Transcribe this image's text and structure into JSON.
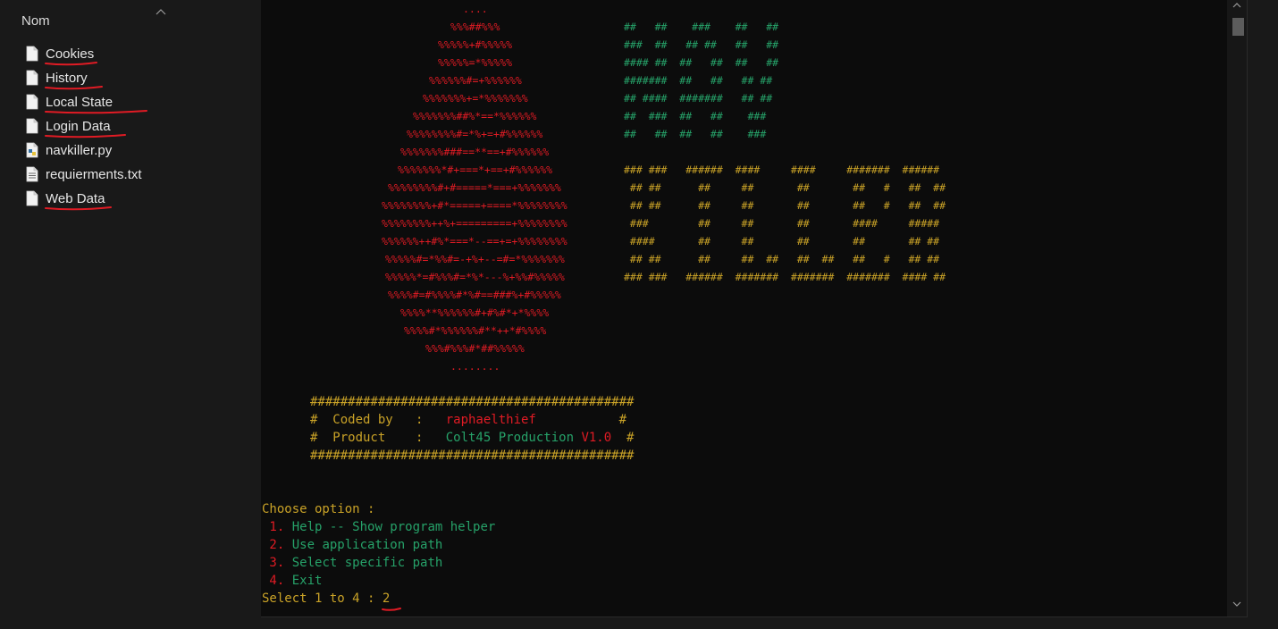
{
  "explorer": {
    "column_header": "Nom",
    "files": [
      {
        "name": "Cookies",
        "icon": "file-icon",
        "underlined": true
      },
      {
        "name": "History",
        "icon": "file-icon",
        "underlined": true
      },
      {
        "name": "Local State",
        "icon": "file-icon",
        "underlined": true
      },
      {
        "name": "Login Data",
        "icon": "file-icon",
        "underlined": true
      },
      {
        "name": "navkiller.py",
        "icon": "python-file-icon",
        "underlined": false
      },
      {
        "name": "requierments.txt",
        "icon": "text-file-icon",
        "underlined": false
      },
      {
        "name": "Web Data",
        "icon": "file-icon",
        "underlined": true
      }
    ]
  },
  "terminal": {
    "colors": {
      "red": "#e01b24",
      "green": "#26a269",
      "yellow": "#c9a227",
      "white": "#cccccc",
      "background": "#0c0c0c",
      "annotation": "#e01b24"
    },
    "logo_art": [
      "....",
      "%%%##%%%",
      "%%%%%+#%%%%%",
      "%%%%%=*%%%%%",
      "%%%%%%#=+%%%%%%",
      "%%%%%%%+=*%%%%%%%",
      "%%%%%%%##%*==*%%%%%%",
      "%%%%%%%%#=*%+=+#%%%%%%",
      "%%%%%%%###==**==+#%%%%%%",
      "%%%%%%%*#+===*+==+#%%%%%%",
      "%%%%%%%%#+#=====*===+%%%%%%%",
      "%%%%%%%%+#*=====+====*%%%%%%%%",
      "%%%%%%%%++%+=========+%%%%%%%%",
      "%%%%%%++#%*===*--==+=+%%%%%%%%",
      "%%%%%#=*%%#=-+%+--=#=*%%%%%%%",
      "%%%%%*=#%%%#=*%*---%+%%#%%%%%",
      "%%%%#=#%%%%#*%#==###%+#%%%%%",
      "%%%%**%%%%%%#+#%#*+*%%%%",
      "%%%%#*%%%%%%#**++*#%%%%",
      "%%%#%%%#*##%%%%%",
      "........"
    ],
    "nav_art": [
      "##   ##    ###    ##   ##",
      "###  ##   ## ##   ##   ##",
      "#### ##  ##   ##  ##   ##",
      "#######  ##   ##   ## ##",
      "## ####  #######   ## ##",
      "##  ###  ##   ##    ###",
      "##   ##  ##   ##    ###"
    ],
    "killer_art": [
      "### ###   ######  ####     ####     #######  ######",
      " ## ##      ##     ##       ##       ##   #   ##  ##",
      " ## ##      ##     ##       ##       ##   #   ##  ##",
      " ###        ##     ##       ##       ####     #####",
      " ####       ##     ##       ##       ##       ## ##",
      " ## ##      ##     ##  ##   ##  ##   ##   #   ## ##",
      "### ###   ######  #######  #######  #######  #### ##"
    ],
    "banner": {
      "border": "###########################################",
      "coded_by_label": "#  Coded by   :   ",
      "coded_by_value": "raphaelthief",
      "coded_by_end": "           #",
      "product_label": "#  Product    :   ",
      "product_name": "Colt45 Production ",
      "product_version": "V1.0",
      "product_end": "  #"
    },
    "menu": {
      "title": "Choose option :",
      "options": [
        {
          "number": " 1.",
          "text": " Help -- Show program helper"
        },
        {
          "number": " 2.",
          "text": " Use application path"
        },
        {
          "number": " 3.",
          "text": " Select specific path"
        },
        {
          "number": " 4.",
          "text": " Exit"
        }
      ],
      "prompt": "Select 1 to 4 : ",
      "input_value": "2"
    }
  },
  "scrollbar": {
    "up_icon": "chevron-up-icon",
    "down_icon": "chevron-down-icon"
  }
}
